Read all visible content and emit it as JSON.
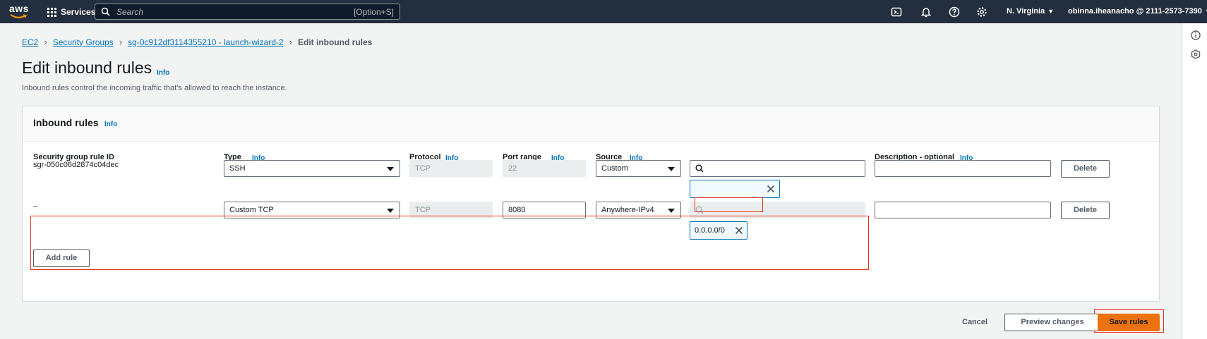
{
  "topnav": {
    "logo": "aws",
    "services_label": "Services",
    "search_placeholder": "Search",
    "search_shortcut": "[Option+S]",
    "icons": [
      "cloudshell-icon",
      "bell-icon",
      "help-icon",
      "gear-icon"
    ],
    "region": "N. Virginia",
    "account": "obinna.iheanacho @ 2111-2573-7390"
  },
  "breadcrumb": {
    "ec2": "EC2",
    "security_groups": "Security Groups",
    "sg": "sg-0c912df3114355210 - launch-wizard-2",
    "current": "Edit inbound rules"
  },
  "page": {
    "title": "Edit inbound rules",
    "title_info": "Info",
    "description": "Inbound rules control the incoming traffic that's allowed to reach the instance."
  },
  "panel": {
    "title": "Inbound rules",
    "title_info": "Info",
    "columns": {
      "rule_id": "Security group rule ID",
      "type": "Type",
      "protocol": "Protocol",
      "port_range": "Port range",
      "source": "Source",
      "description": "Description - optional"
    },
    "column_info": "Info",
    "rules": [
      {
        "rule_id": "sgr-050c06d2874c04dec",
        "type": "SSH",
        "protocol": "TCP",
        "port_range": "22",
        "source": "Custom",
        "source_search": "",
        "token": "",
        "description": "",
        "delete_label": "Delete"
      },
      {
        "rule_id": "–",
        "type": "Custom TCP",
        "protocol": "TCP",
        "port_range": "8080",
        "source": "Anywhere-IPv4",
        "source_search": "",
        "token": "0.0.0.0/0",
        "description": "",
        "delete_label": "Delete"
      }
    ],
    "add_rule_label": "Add rule"
  },
  "footer": {
    "cancel_label": "Cancel",
    "preview_label": "Preview changes",
    "save_label": "Save rules"
  },
  "colors": {
    "nav_bg": "#232f3e",
    "link": "#0073bb",
    "primary": "#ec7211",
    "highlight": "#e8321f"
  }
}
